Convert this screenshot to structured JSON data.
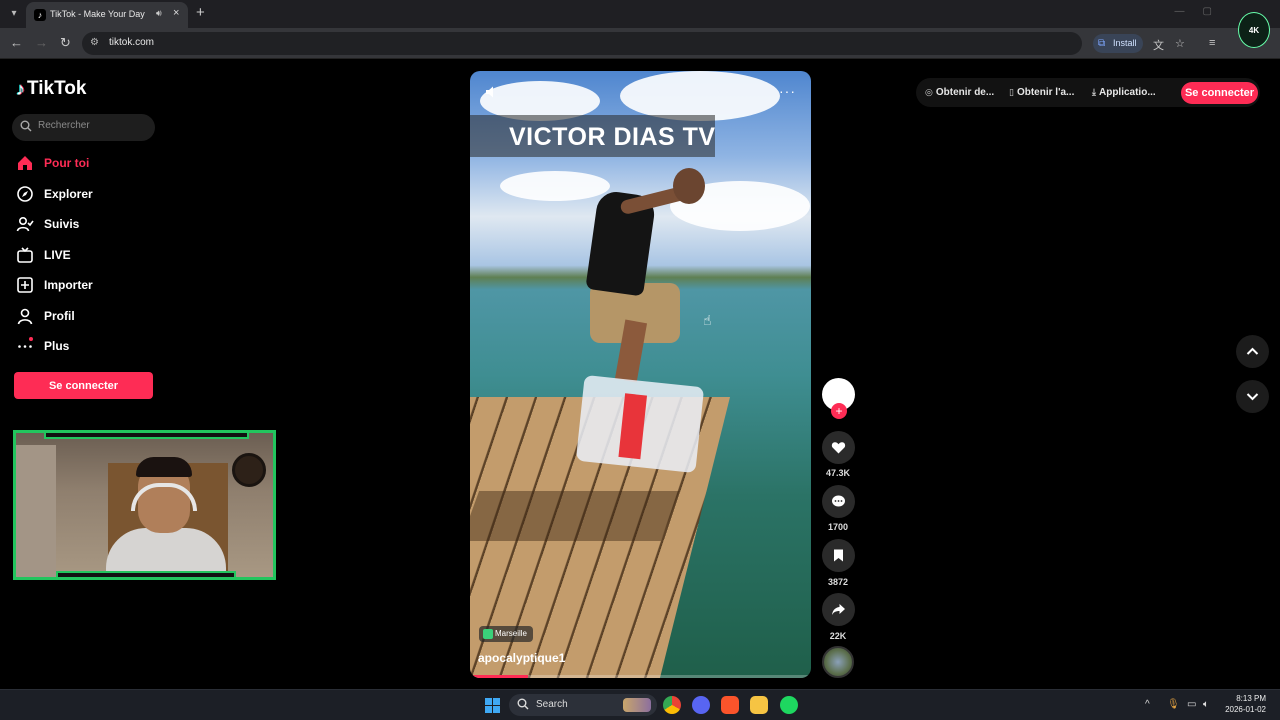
{
  "browser": {
    "tab_title": "TikTok - Make Your Day",
    "url": "tiktok.com",
    "install_label": "Install",
    "brand_badge": "4K"
  },
  "tiktok": {
    "logo_text": "TikTok",
    "search_placeholder": "Rechercher",
    "nav": [
      {
        "label": "Pour toi",
        "icon": "home-icon",
        "active": true
      },
      {
        "label": "Explorer",
        "icon": "compass-icon"
      },
      {
        "label": "Suivis",
        "icon": "following-icon"
      },
      {
        "label": "LIVE",
        "icon": "live-tv-icon"
      },
      {
        "label": "Importer",
        "icon": "upload-icon"
      },
      {
        "label": "Profil",
        "icon": "profile-icon"
      },
      {
        "label": "Plus",
        "icon": "more-dots-icon"
      }
    ],
    "login_label": "Se connecter",
    "accent_color": "#fe2c55"
  },
  "topbar": {
    "links": [
      {
        "label": "Obtenir de...",
        "icon": "coin-icon"
      },
      {
        "label": "Obtenir l'a...",
        "icon": "phone-icon"
      },
      {
        "label": "Applicatio...",
        "icon": "download-icon"
      }
    ],
    "login_label": "Se connecter"
  },
  "video": {
    "overlay_title": "VICTOR DIAS TV",
    "location": "Marseille",
    "username": "apocalyptique1",
    "progress_fraction": 0.17
  },
  "actions": {
    "likes": "47.3K",
    "comments": "1700",
    "saves": "3872",
    "shares": "22K"
  },
  "taskbar": {
    "search_label": "Search",
    "time": "8:13 PM",
    "date": "2026-01-02"
  }
}
